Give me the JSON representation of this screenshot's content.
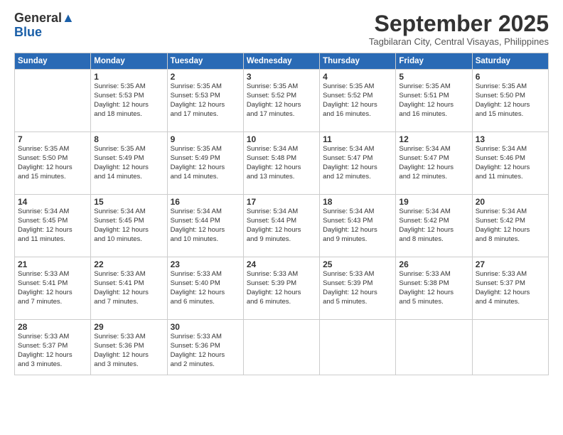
{
  "logo": {
    "general": "General",
    "blue": "Blue"
  },
  "header": {
    "month": "September 2025",
    "location": "Tagbilaran City, Central Visayas, Philippines"
  },
  "days_of_week": [
    "Sunday",
    "Monday",
    "Tuesday",
    "Wednesday",
    "Thursday",
    "Friday",
    "Saturday"
  ],
  "weeks": [
    [
      {
        "day": "",
        "info": ""
      },
      {
        "day": "1",
        "info": "Sunrise: 5:35 AM\nSunset: 5:53 PM\nDaylight: 12 hours\nand 18 minutes."
      },
      {
        "day": "2",
        "info": "Sunrise: 5:35 AM\nSunset: 5:53 PM\nDaylight: 12 hours\nand 17 minutes."
      },
      {
        "day": "3",
        "info": "Sunrise: 5:35 AM\nSunset: 5:52 PM\nDaylight: 12 hours\nand 17 minutes."
      },
      {
        "day": "4",
        "info": "Sunrise: 5:35 AM\nSunset: 5:52 PM\nDaylight: 12 hours\nand 16 minutes."
      },
      {
        "day": "5",
        "info": "Sunrise: 5:35 AM\nSunset: 5:51 PM\nDaylight: 12 hours\nand 16 minutes."
      },
      {
        "day": "6",
        "info": "Sunrise: 5:35 AM\nSunset: 5:50 PM\nDaylight: 12 hours\nand 15 minutes."
      }
    ],
    [
      {
        "day": "7",
        "info": "Sunrise: 5:35 AM\nSunset: 5:50 PM\nDaylight: 12 hours\nand 15 minutes."
      },
      {
        "day": "8",
        "info": "Sunrise: 5:35 AM\nSunset: 5:49 PM\nDaylight: 12 hours\nand 14 minutes."
      },
      {
        "day": "9",
        "info": "Sunrise: 5:35 AM\nSunset: 5:49 PM\nDaylight: 12 hours\nand 14 minutes."
      },
      {
        "day": "10",
        "info": "Sunrise: 5:34 AM\nSunset: 5:48 PM\nDaylight: 12 hours\nand 13 minutes."
      },
      {
        "day": "11",
        "info": "Sunrise: 5:34 AM\nSunset: 5:47 PM\nDaylight: 12 hours\nand 12 minutes."
      },
      {
        "day": "12",
        "info": "Sunrise: 5:34 AM\nSunset: 5:47 PM\nDaylight: 12 hours\nand 12 minutes."
      },
      {
        "day": "13",
        "info": "Sunrise: 5:34 AM\nSunset: 5:46 PM\nDaylight: 12 hours\nand 11 minutes."
      }
    ],
    [
      {
        "day": "14",
        "info": "Sunrise: 5:34 AM\nSunset: 5:45 PM\nDaylight: 12 hours\nand 11 minutes."
      },
      {
        "day": "15",
        "info": "Sunrise: 5:34 AM\nSunset: 5:45 PM\nDaylight: 12 hours\nand 10 minutes."
      },
      {
        "day": "16",
        "info": "Sunrise: 5:34 AM\nSunset: 5:44 PM\nDaylight: 12 hours\nand 10 minutes."
      },
      {
        "day": "17",
        "info": "Sunrise: 5:34 AM\nSunset: 5:44 PM\nDaylight: 12 hours\nand 9 minutes."
      },
      {
        "day": "18",
        "info": "Sunrise: 5:34 AM\nSunset: 5:43 PM\nDaylight: 12 hours\nand 9 minutes."
      },
      {
        "day": "19",
        "info": "Sunrise: 5:34 AM\nSunset: 5:42 PM\nDaylight: 12 hours\nand 8 minutes."
      },
      {
        "day": "20",
        "info": "Sunrise: 5:34 AM\nSunset: 5:42 PM\nDaylight: 12 hours\nand 8 minutes."
      }
    ],
    [
      {
        "day": "21",
        "info": "Sunrise: 5:33 AM\nSunset: 5:41 PM\nDaylight: 12 hours\nand 7 minutes."
      },
      {
        "day": "22",
        "info": "Sunrise: 5:33 AM\nSunset: 5:41 PM\nDaylight: 12 hours\nand 7 minutes."
      },
      {
        "day": "23",
        "info": "Sunrise: 5:33 AM\nSunset: 5:40 PM\nDaylight: 12 hours\nand 6 minutes."
      },
      {
        "day": "24",
        "info": "Sunrise: 5:33 AM\nSunset: 5:39 PM\nDaylight: 12 hours\nand 6 minutes."
      },
      {
        "day": "25",
        "info": "Sunrise: 5:33 AM\nSunset: 5:39 PM\nDaylight: 12 hours\nand 5 minutes."
      },
      {
        "day": "26",
        "info": "Sunrise: 5:33 AM\nSunset: 5:38 PM\nDaylight: 12 hours\nand 5 minutes."
      },
      {
        "day": "27",
        "info": "Sunrise: 5:33 AM\nSunset: 5:37 PM\nDaylight: 12 hours\nand 4 minutes."
      }
    ],
    [
      {
        "day": "28",
        "info": "Sunrise: 5:33 AM\nSunset: 5:37 PM\nDaylight: 12 hours\nand 3 minutes."
      },
      {
        "day": "29",
        "info": "Sunrise: 5:33 AM\nSunset: 5:36 PM\nDaylight: 12 hours\nand 3 minutes."
      },
      {
        "day": "30",
        "info": "Sunrise: 5:33 AM\nSunset: 5:36 PM\nDaylight: 12 hours\nand 2 minutes."
      },
      {
        "day": "",
        "info": ""
      },
      {
        "day": "",
        "info": ""
      },
      {
        "day": "",
        "info": ""
      },
      {
        "day": "",
        "info": ""
      }
    ]
  ]
}
